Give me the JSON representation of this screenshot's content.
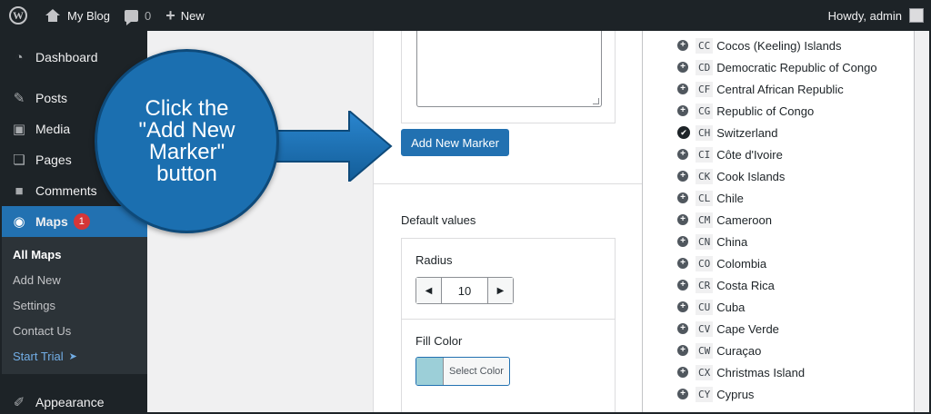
{
  "adminbar": {
    "site_name": "My Blog",
    "comments_count": "0",
    "new_label": "New",
    "greeting": "Howdy, admin"
  },
  "sidebar": {
    "items": [
      {
        "label": "Dashboard",
        "icon": "dashboard-icon"
      },
      {
        "label": "Posts",
        "icon": "pin-icon"
      },
      {
        "label": "Media",
        "icon": "media-icon"
      },
      {
        "label": "Pages",
        "icon": "pages-icon"
      },
      {
        "label": "Comments",
        "icon": "comment-icon"
      },
      {
        "label": "Maps",
        "icon": "globe-icon",
        "badge": "1"
      },
      {
        "label": "Appearance",
        "icon": "brush-icon"
      }
    ],
    "submenu": [
      {
        "label": "All Maps"
      },
      {
        "label": "Add New"
      },
      {
        "label": "Settings"
      },
      {
        "label": "Contact Us"
      },
      {
        "label": "Start Trial"
      }
    ],
    "trial_arrow": "➤"
  },
  "panel": {
    "add_marker_label": "Add New Marker",
    "default_values_label": "Default values",
    "radius_label": "Radius",
    "radius_value": "10",
    "fill_color_label": "Fill Color",
    "select_color_label": "Select Color",
    "swatch_color": "#9ccfd8"
  },
  "countries": [
    {
      "code": "CC",
      "name": "Cocos (Keeling) Islands",
      "selected": false
    },
    {
      "code": "CD",
      "name": "Democratic Republic of Congo",
      "selected": false
    },
    {
      "code": "CF",
      "name": "Central African Republic",
      "selected": false
    },
    {
      "code": "CG",
      "name": "Republic of Congo",
      "selected": false
    },
    {
      "code": "CH",
      "name": "Switzerland",
      "selected": true
    },
    {
      "code": "CI",
      "name": "Côte d'Ivoire",
      "selected": false
    },
    {
      "code": "CK",
      "name": "Cook Islands",
      "selected": false
    },
    {
      "code": "CL",
      "name": "Chile",
      "selected": false
    },
    {
      "code": "CM",
      "name": "Cameroon",
      "selected": false
    },
    {
      "code": "CN",
      "name": "China",
      "selected": false
    },
    {
      "code": "CO",
      "name": "Colombia",
      "selected": false
    },
    {
      "code": "CR",
      "name": "Costa Rica",
      "selected": false
    },
    {
      "code": "CU",
      "name": "Cuba",
      "selected": false
    },
    {
      "code": "CV",
      "name": "Cape Verde",
      "selected": false
    },
    {
      "code": "CW",
      "name": "Curaçao",
      "selected": false
    },
    {
      "code": "CX",
      "name": "Christmas Island",
      "selected": false
    },
    {
      "code": "CY",
      "name": "Cyprus",
      "selected": false
    }
  ],
  "callout": {
    "text": "Click the\n\"Add New\nMarker\"\nbutton",
    "color": "#1b6fb0"
  }
}
